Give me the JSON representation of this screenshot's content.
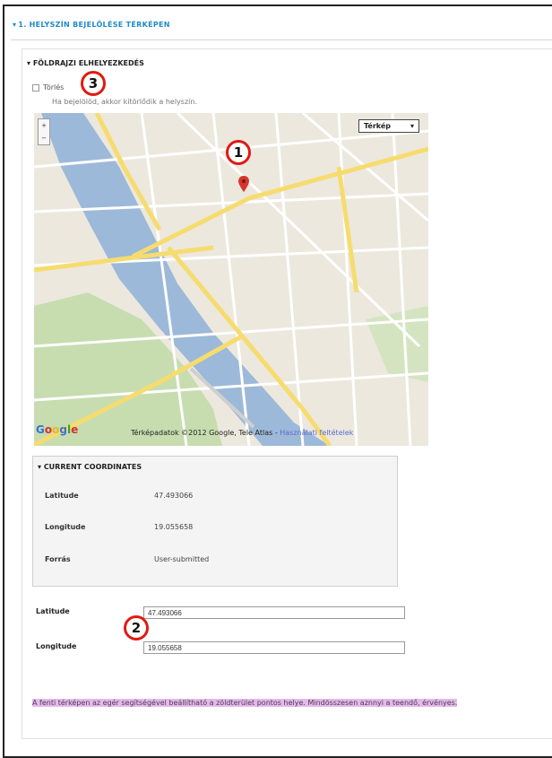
{
  "section": {
    "title": "1. HELYSZÍN BEJELÖLÉSE TÉRKÉPEN",
    "triangle": "▾"
  },
  "geo": {
    "legend": "FÖLDRAJZI ELHELYEZKEDÉS",
    "delete_label": "Törlés",
    "delete_help": "Ha bejelölöd, akkor kitörlődik a helyszín."
  },
  "map": {
    "type_selector": "Térkép",
    "type_arrow": "▾",
    "zoom_plus": "+",
    "zoom_minus": "−",
    "google_logo": "Google",
    "attribution": "Térképadatok ©2012 Google, Tele Atlas - ",
    "attribution_link": "Használati feltételek",
    "colors": {
      "river": "#9db9d9",
      "park": "#c7ddb0",
      "road": "#f6dc6f",
      "land": "#ece8de"
    }
  },
  "current": {
    "title": "CURRENT COORDINATES",
    "rows": [
      {
        "label": "Latitude",
        "value": "47.493066"
      },
      {
        "label": "Longitude",
        "value": "19.055658"
      },
      {
        "label": "Forrás",
        "value": "User-submitted"
      }
    ]
  },
  "inputs": {
    "latitude_label": "Latitude",
    "latitude_value": "47.493066",
    "longitude_label": "Longitude",
    "longitude_value": "19.055658"
  },
  "note": "A fenti térképen az egér segítségével beállítható a zöldterület pontos helye. Mindösszesen aznnyi a teendő, érvényes.",
  "badges": {
    "one": "1",
    "two": "2",
    "three": "3"
  },
  "badge_color": "#e01a12"
}
